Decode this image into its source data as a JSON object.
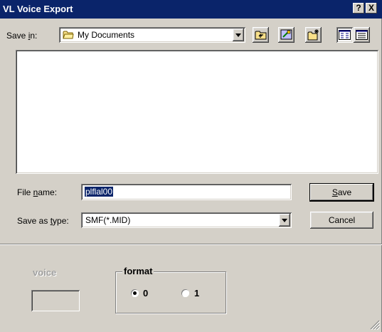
{
  "window": {
    "title": "VL Voice Export",
    "help_glyph": "?",
    "close_glyph": "X"
  },
  "toolbar": {
    "save_in_label_pre": "Save ",
    "save_in_label_key": "i",
    "save_in_label_post": "n:",
    "folder": "My Documents",
    "icons": [
      "up-folder-icon",
      "desktop-icon",
      "new-folder-icon",
      "list-view-icon",
      "details-view-icon"
    ]
  },
  "file_list": {
    "items": []
  },
  "file_name": {
    "label_pre": "File ",
    "label_key": "n",
    "label_post": "ame:",
    "value": "plflal00"
  },
  "save_type": {
    "label_pre": "Save as ",
    "label_key": "t",
    "label_post": "ype:",
    "value": "SMF(*.MID)"
  },
  "buttons": {
    "save_key": "S",
    "save_rest": "ave",
    "cancel": "Cancel"
  },
  "voice": {
    "label": "voice",
    "value": ""
  },
  "format": {
    "label": "format",
    "options": [
      {
        "label": "0",
        "selected": true
      },
      {
        "label": "1",
        "selected": false
      }
    ]
  }
}
